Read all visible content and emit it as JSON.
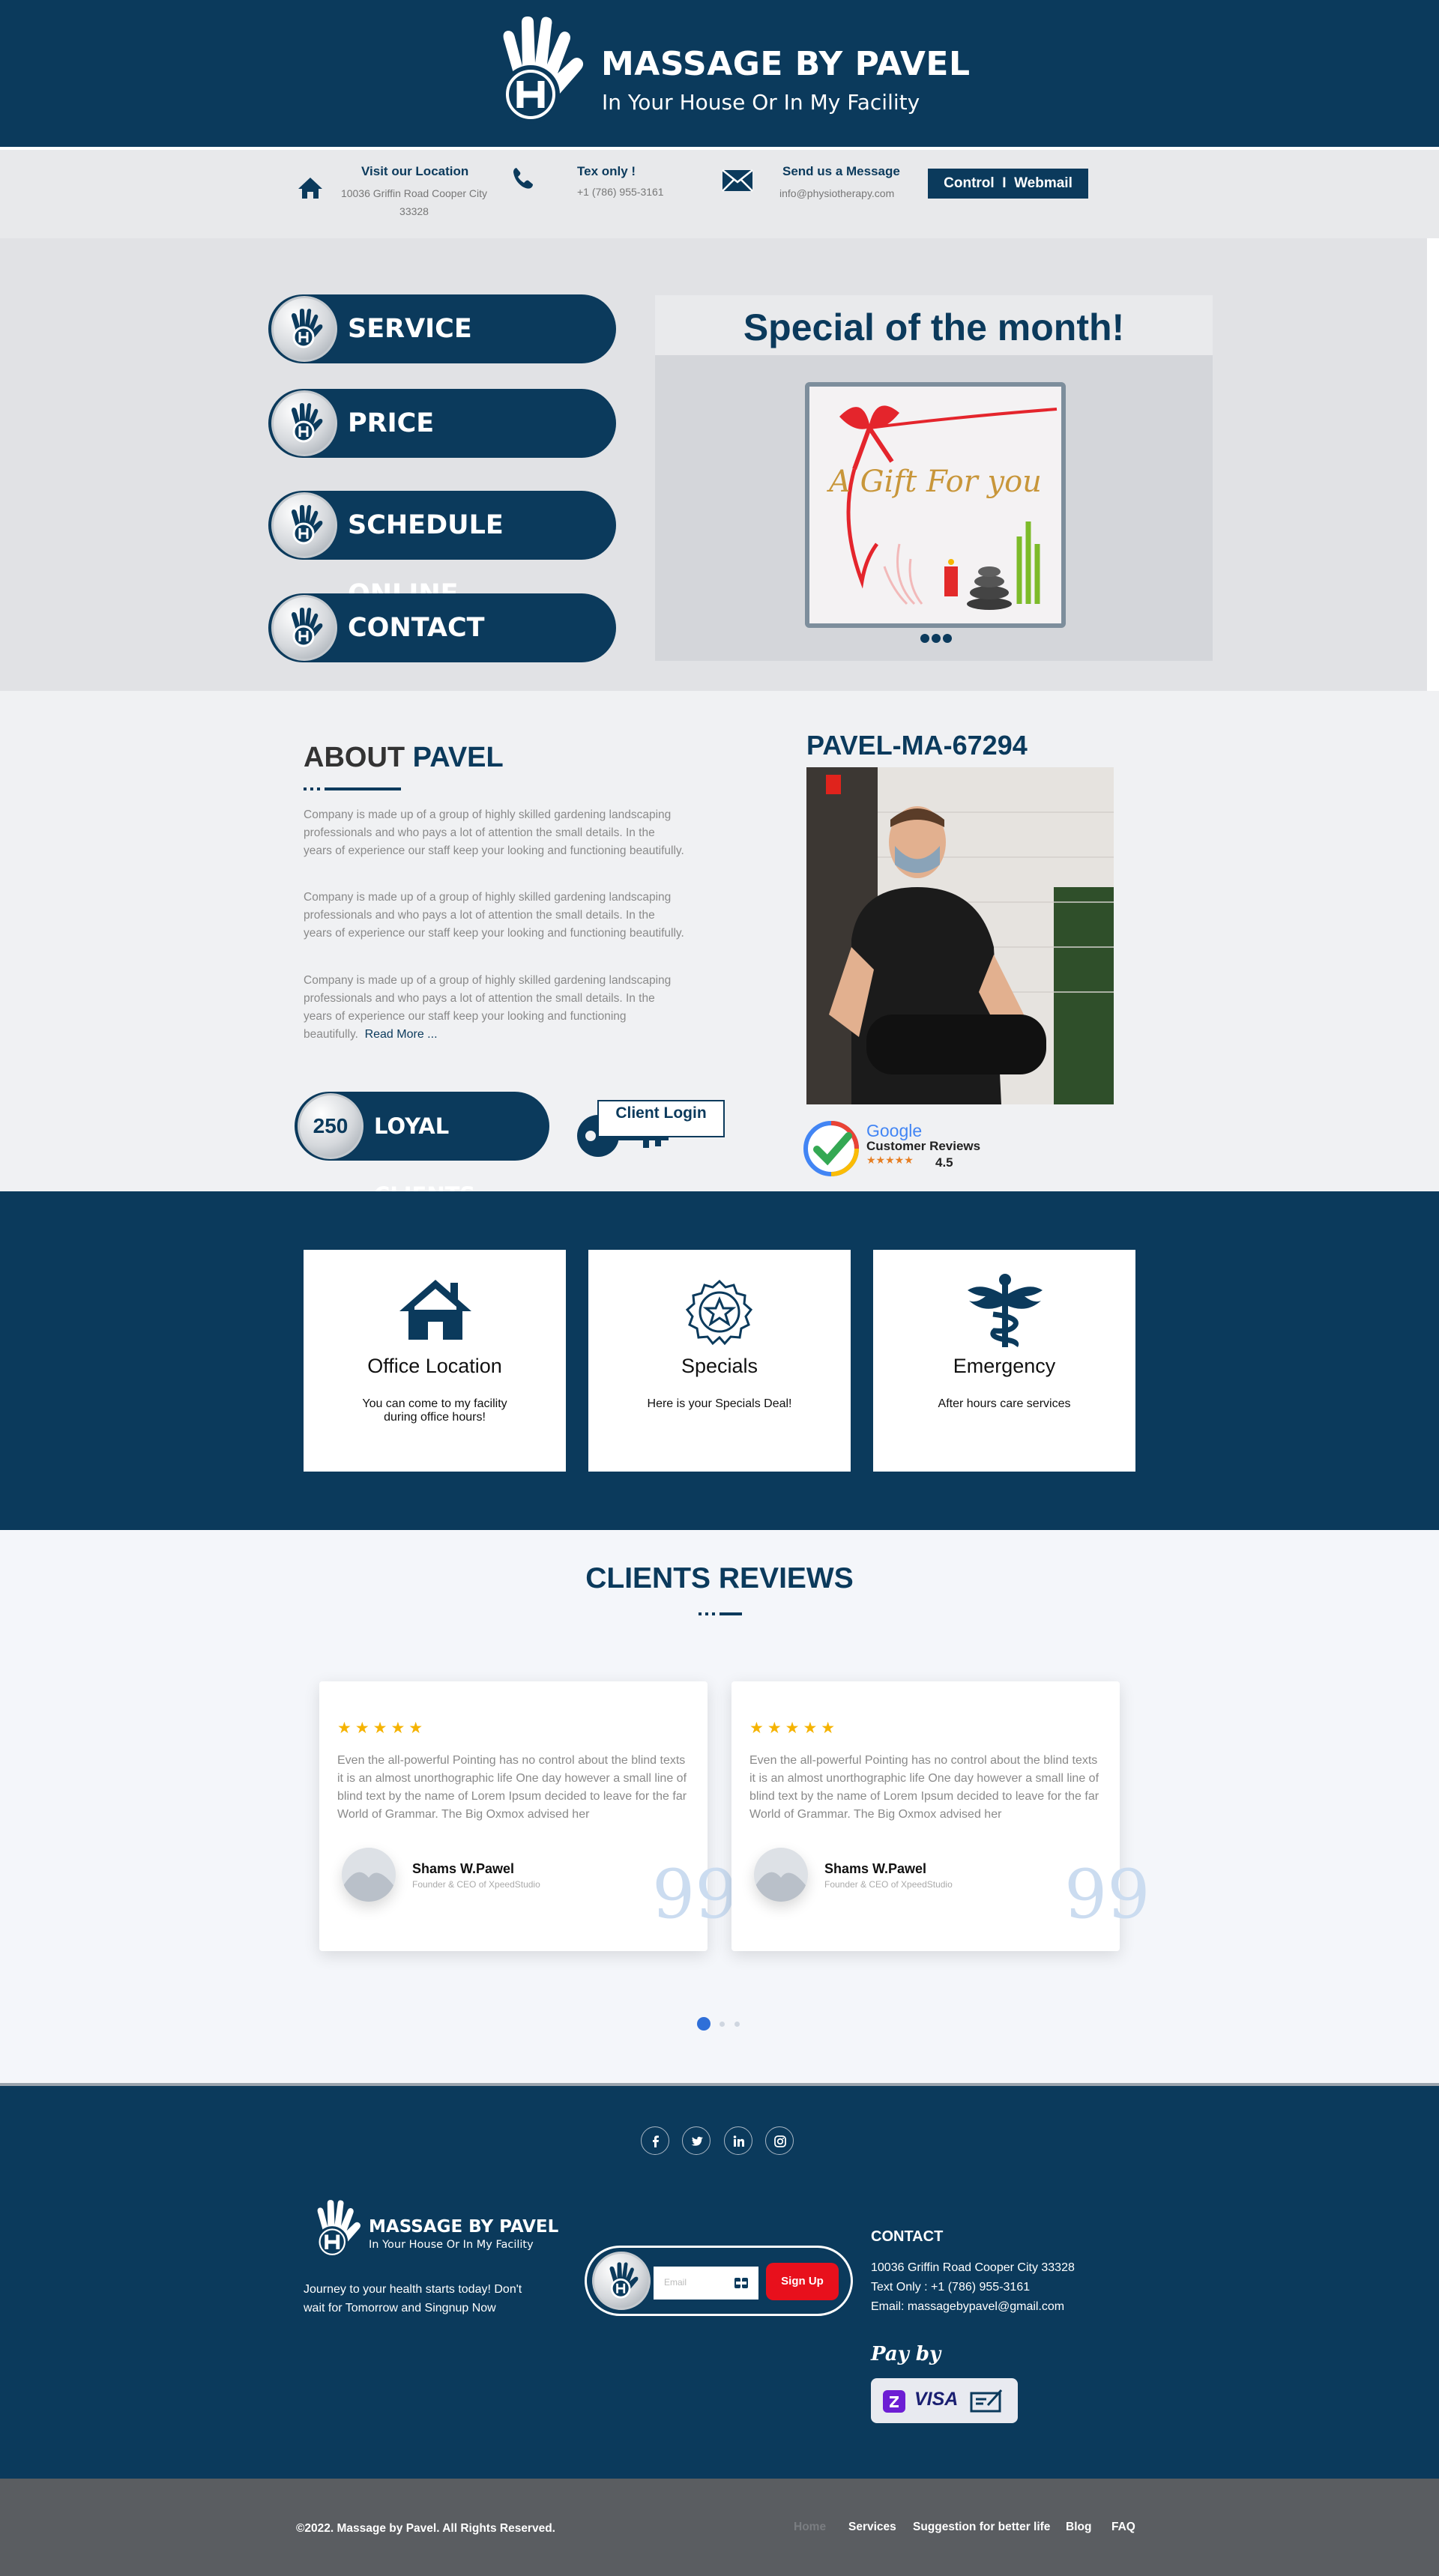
{
  "colors": {
    "brand_navy": "#0b3a5c",
    "accent_red": "#e8101c",
    "star_gold": "#f5b301"
  },
  "header": {
    "title": "MASSAGE BY PAVEL",
    "subtitle": "In Your House Or In My Facility"
  },
  "contact_bar": {
    "location_title": "Visit our Location",
    "location_line1": "10036 Griffin Road Cooper City",
    "location_line2": "33328",
    "text_title": "Tex only !",
    "text_phone": "+1 (786) 955-3161",
    "message_title": "Send us a Message",
    "message_email": "info@physiotherapy.com",
    "webmail_button": "Control  I  Webmail"
  },
  "menu": [
    "SERVICE",
    "PRICE",
    "SCHEDULE ONLINE",
    "CONTACT"
  ],
  "special": {
    "title": "Special of the month!",
    "image_text": "A Gift For you"
  },
  "about": {
    "title_dark": "ABOUT",
    "title_accent": "PAVEL",
    "paragraph": "Company is made up of a group of highly skilled gardening landscaping professionals and who pays a lot of attention the small details. In the years of experience our staff keep your looking and functioning beautifully.",
    "read_more": "Read More ...",
    "loyal_count": "250",
    "loyal_label": "LOYAL CLIENTS",
    "client_login": "Client Login",
    "license_id": "PAVEL-MA-67294",
    "google_brand": "Google",
    "google_reviews": "Customer Reviews",
    "google_stars": "★★★★★",
    "google_rating": "4.5"
  },
  "features": [
    {
      "title": "Office Location",
      "text": "You can come to my facility during office hours!",
      "icon": "house-icon"
    },
    {
      "title": "Specials",
      "text": "Here is your Specials Deal!",
      "icon": "star-seal-icon"
    },
    {
      "title": "Emergency",
      "text": "After hours care services",
      "icon": "caduceus-icon"
    }
  ],
  "reviews": {
    "title": "CLIENTS REVIEWS",
    "items": [
      {
        "stars": "★★★★★",
        "text": "Even the all-powerful Pointing has no control about the blind texts it is an almost unorthographic life One day however a small line of blind text by the name of Lorem Ipsum decided to leave for the far World of Grammar. The Big Oxmox advised her",
        "name": "Shams W.Pawel",
        "role": "Founder & CEO of XpeedStudio"
      },
      {
        "stars": "★★★★★",
        "text": "Even the all-powerful Pointing has no control about the blind texts it is an almost unorthographic life One day however a small line of blind text by the name of Lorem Ipsum decided to leave for the far World of Grammar. The Big Oxmox advised her",
        "name": "Shams W.Pawel",
        "role": "Founder & CEO of XpeedStudio"
      }
    ],
    "quote_mark": "99"
  },
  "footer": {
    "brand": "MASSAGE BY PAVEL",
    "brand_sub": "In Your House Or In My Facility",
    "tagline": "Journey to your health starts today! Don't wait for Tomorrow and Singnup Now",
    "email_placeholder": "Email",
    "signup_button": "Sign Up",
    "contact_title": "CONTACT",
    "contact_address": "10036 Griffin Road Cooper City 33328",
    "contact_text": "Text Only : +1 (786) 955-3161",
    "contact_email": "Email: massagebypavel@gmail.com",
    "pay_by": "Pay by",
    "pay_visa": "VISA",
    "copyright": "©2022. Massage by Pavel. All Rights Reserved.",
    "nav": [
      "Home",
      "Services",
      "Suggestion for better life",
      "Blog",
      "FAQ"
    ]
  }
}
